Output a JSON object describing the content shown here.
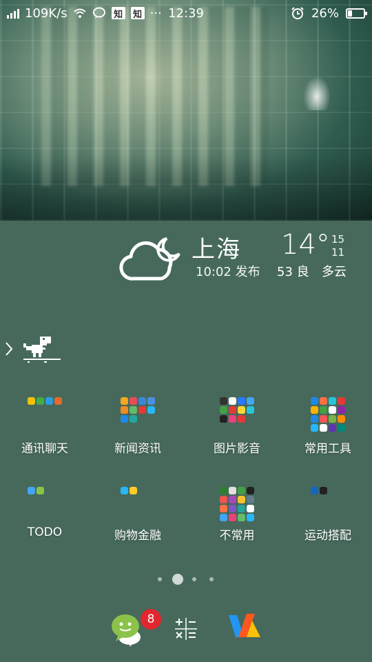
{
  "status_bar": {
    "speed": "109K/s",
    "zhihu_a": "知",
    "zhihu_b": "知",
    "more": "···",
    "time": "12:39",
    "battery": "26%",
    "battery_level": 0.26
  },
  "weather": {
    "city": "上海",
    "publish_time": "10:02 发布",
    "temperature": "14°",
    "high": "15",
    "low": "11",
    "aqi": "53 良",
    "condition": "多云"
  },
  "folders": [
    {
      "label": "通讯聊天",
      "icons": [
        "#f2c200",
        "#3fae49",
        "#2c9be0",
        "#e46a2a"
      ]
    },
    {
      "label": "新闻资讯",
      "icons": [
        "#f5a623",
        "#e94b5a",
        "#3a86d8",
        "#4a90e2",
        "#f08a24",
        "#66bb6a",
        "#e53935",
        "#29b6f6",
        "#1e88e5",
        "#26a69a"
      ]
    },
    {
      "label": "图片影音",
      "icons": [
        "#333333",
        "#ffffff",
        "#2979ff",
        "#42a5f5",
        "#43a047",
        "#e53935",
        "#fdd835",
        "#26c6da",
        "#222222",
        "#ec407a",
        "#e53935"
      ]
    },
    {
      "label": "常用工具",
      "icons": [
        "#1e88e5",
        "#ff7043",
        "#26c6da",
        "#e53935",
        "#ffb300",
        "#43a047",
        "#ffffff",
        "#8e24aa",
        "#1e88e5",
        "#ff5252",
        "#7cb342",
        "#fb8c00",
        "#29b6f6",
        "#ffffff",
        "#5e35b1",
        "#00897b"
      ]
    },
    {
      "label": "TODO",
      "icons": [
        "#42a5f5",
        "#8bc34a"
      ]
    },
    {
      "label": "购物金融",
      "icons": [
        "#29b6f6",
        "#ffca28"
      ]
    },
    {
      "label": "不常用",
      "icons": [
        "#2e7d32",
        "#e0e0e0",
        "#43a047",
        "#212121",
        "#ef5350",
        "#ab47bc",
        "#fbc02d",
        "#607d8b",
        "#ff7043",
        "#7e57c2",
        "#26a69a",
        "#ffffff",
        "#42a5f5",
        "#ec407a",
        "#66bb6a",
        "#29b6f6"
      ]
    },
    {
      "label": "运动搭配",
      "icons": [
        "#1565c0",
        "#212121"
      ]
    }
  ],
  "dock": {
    "messages_badge": "8",
    "apps": [
      "messages-icon",
      "calculator-icon",
      "app-icon"
    ]
  },
  "pages": {
    "count": 4,
    "current": 2
  },
  "colors": {
    "background": "#46695b",
    "badge": "#e3262f",
    "wechat_green": "#8bc34a"
  }
}
